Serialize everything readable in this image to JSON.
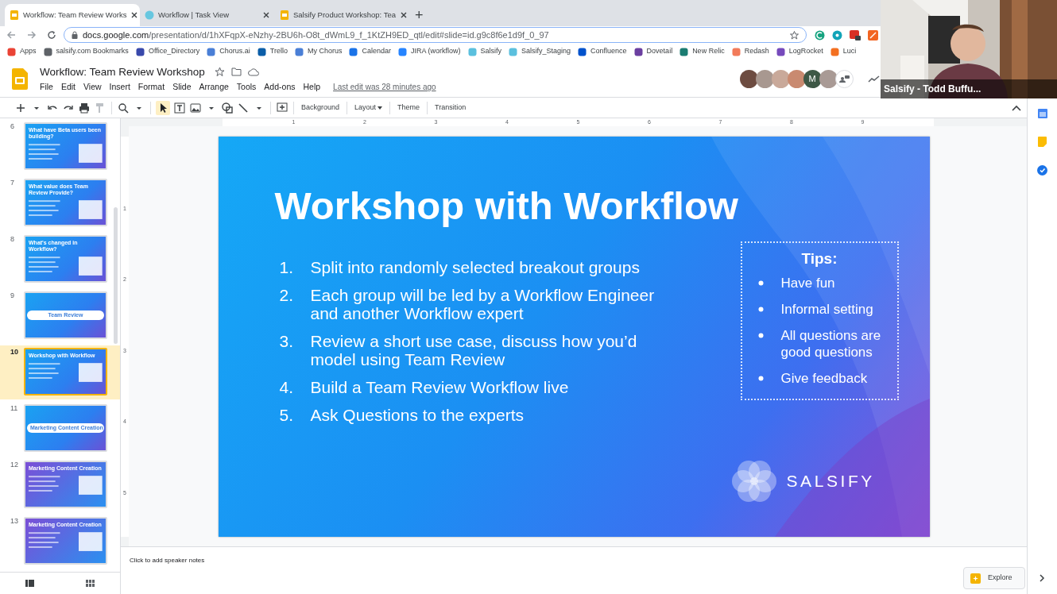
{
  "browser": {
    "tabs": [
      {
        "title": "Workflow: Team Review Works",
        "selected": true,
        "kind": "slides"
      },
      {
        "title": "Workflow | Task View",
        "selected": false,
        "kind": "web"
      },
      {
        "title": "Salsify Product Workshop: Tea",
        "selected": false,
        "kind": "slides"
      }
    ],
    "new_tab": "+",
    "url": {
      "host": "docs.google.com",
      "path": "/presentation/d/1hXFqpX-eNzhy-2BU6h-O8t_dWmL9_f_1KtZH9ED_qtl/edit#slide=id.g9c8f6e1d9f_0_97"
    },
    "bookmarks": [
      {
        "label": "Apps",
        "color": "#ea4335"
      },
      {
        "label": "salsify.com Bookmarks",
        "color": "#5f6368"
      },
      {
        "label": "Office_Directory",
        "color": "#3949ab"
      },
      {
        "label": "Chorus.ai",
        "color": "#4a7fd6"
      },
      {
        "label": "Trello",
        "color": "#0b5ea8"
      },
      {
        "label": "My Chorus",
        "color": "#4a7fd6"
      },
      {
        "label": "Calendar",
        "color": "#1a73e8"
      },
      {
        "label": "JIRA (workflow)",
        "color": "#2684ff"
      },
      {
        "label": "Salsify",
        "color": "#5bc0de"
      },
      {
        "label": "Salsify_Staging",
        "color": "#5bc0de"
      },
      {
        "label": "Confluence",
        "color": "#0052cc"
      },
      {
        "label": "Dovetail",
        "color": "#6b3fa0"
      },
      {
        "label": "New Relic",
        "color": "#1b7c72"
      },
      {
        "label": "Redash",
        "color": "#f27b5a"
      },
      {
        "label": "LogRocket",
        "color": "#764abc"
      },
      {
        "label": "Luci",
        "color": "#f37021"
      }
    ]
  },
  "video_overlay": {
    "caption": "Salsify - Todd Buffu..."
  },
  "app": {
    "title": "Workflow: Team Review Workshop",
    "menu": [
      "File",
      "Edit",
      "View",
      "Insert",
      "Format",
      "Slide",
      "Arrange",
      "Tools",
      "Add-ons",
      "Help"
    ],
    "last_edit": "Last edit was 28 minutes ago",
    "collaborators": [
      {
        "color": "#6d4c41"
      },
      {
        "color": "#a89890"
      },
      {
        "color": "#c9a99a"
      },
      {
        "color": "#c98a70"
      },
      {
        "color": "#3e5846",
        "initial": "M"
      },
      {
        "color": "#a99a95"
      }
    ]
  },
  "toolbar": {
    "buttons": [
      {
        "label": "Background",
        "dropdown": false
      },
      {
        "label": "Layout",
        "dropdown": true
      },
      {
        "label": "Theme",
        "dropdown": false
      },
      {
        "label": "Transition",
        "dropdown": false
      }
    ]
  },
  "filmstrip": {
    "slides": [
      {
        "number": "6",
        "title": "What have Beta users been building?",
        "kind": "content",
        "selected": false
      },
      {
        "number": "7",
        "title": "What value does Team Review Provide?",
        "kind": "content",
        "selected": false
      },
      {
        "number": "8",
        "title": "What's changed in Workflow?",
        "kind": "content",
        "selected": false
      },
      {
        "number": "9",
        "title": "Team Review",
        "kind": "section",
        "selected": false
      },
      {
        "number": "10",
        "title": "Workshop with Workflow",
        "kind": "content",
        "selected": true
      },
      {
        "number": "11",
        "title": "Marketing Content Creation",
        "kind": "section",
        "selected": false
      },
      {
        "number": "12",
        "title": "Marketing Content Creation",
        "kind": "content",
        "selected": false
      },
      {
        "number": "13",
        "title": "Marketing Content Creation",
        "kind": "content",
        "selected": false
      }
    ]
  },
  "ruler": {
    "horizontal": [
      "1",
      "2",
      "3",
      "4",
      "5",
      "6",
      "7",
      "8",
      "9"
    ],
    "vertical": [
      "1",
      "2",
      "3",
      "4",
      "5"
    ]
  },
  "slide": {
    "title": "Workshop with Workflow",
    "steps": [
      {
        "number": "1.",
        "text": "Split into randomly selected breakout groups"
      },
      {
        "number": "2.",
        "text": "Each group will be led by a Workflow Engineer and another Workflow expert"
      },
      {
        "number": "3.",
        "text": "Review a short use case, discuss how you’d model using Team Review"
      },
      {
        "number": "4.",
        "text": "Build a Team Review Workflow live"
      },
      {
        "number": "5.",
        "text": "Ask Questions to the experts"
      }
    ],
    "tips": {
      "heading": "Tips:",
      "items": [
        "Have fun",
        "Informal setting",
        "All questions are good questions",
        "Give feedback"
      ]
    },
    "logo_text": "SALSIFY"
  },
  "notes": {
    "placeholder": "Click to add speaker notes"
  },
  "explore": "Explore"
}
